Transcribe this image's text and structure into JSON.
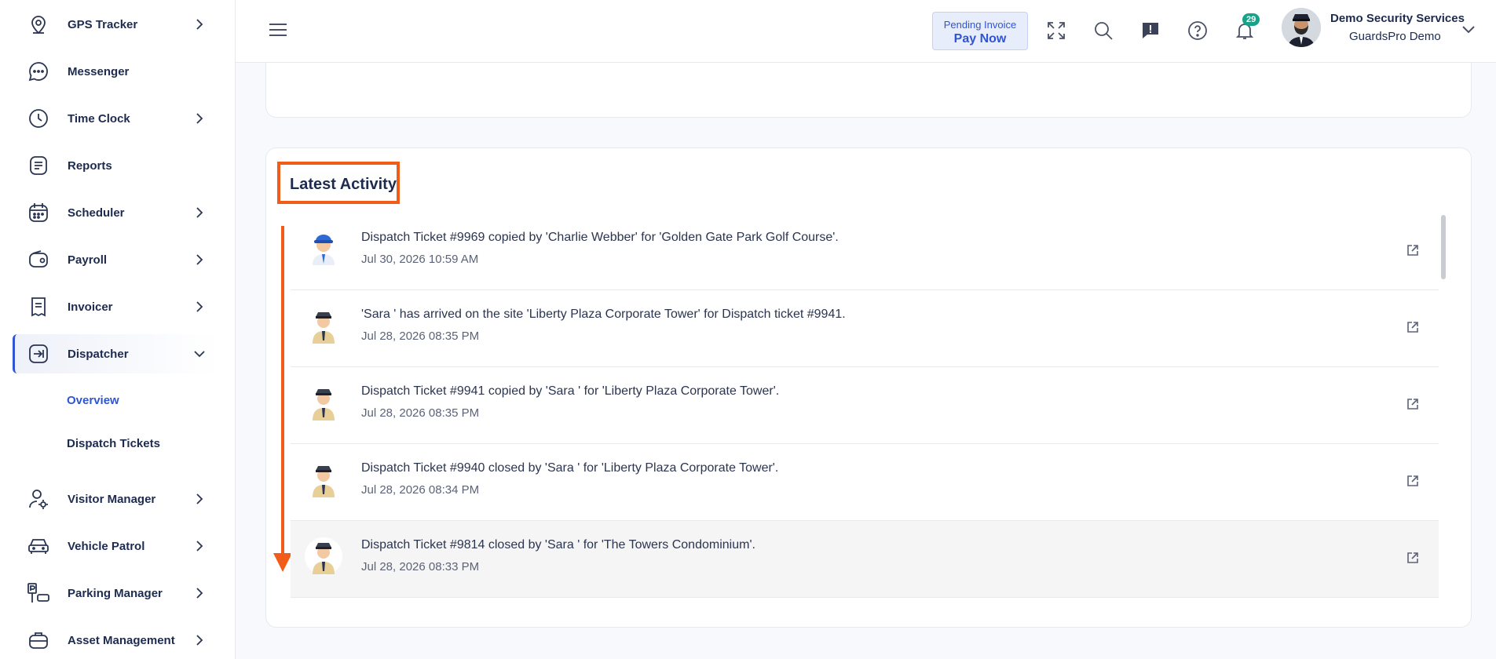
{
  "sidebar": {
    "items": [
      {
        "label": "GPS Tracker",
        "icon": "location-pin-icon"
      },
      {
        "label": "Messenger",
        "icon": "chat-bubble-icon"
      },
      {
        "label": "Time Clock",
        "icon": "clock-icon"
      },
      {
        "label": "Reports",
        "icon": "document-list-icon"
      },
      {
        "label": "Scheduler",
        "icon": "calendar-icon"
      },
      {
        "label": "Payroll",
        "icon": "wallet-icon"
      },
      {
        "label": "Invoicer",
        "icon": "receipt-icon"
      },
      {
        "label": "Dispatcher",
        "icon": "dispatch-icon"
      },
      {
        "label": "Visitor Manager",
        "icon": "visitor-icon"
      },
      {
        "label": "Vehicle Patrol",
        "icon": "car-icon"
      },
      {
        "label": "Parking Manager",
        "icon": "parking-icon"
      },
      {
        "label": "Asset Management",
        "icon": "briefcase-icon"
      }
    ],
    "sub_items": [
      {
        "label": "Overview"
      },
      {
        "label": "Dispatch Tickets"
      }
    ]
  },
  "header": {
    "pending_label": "Pending Invoice",
    "pay_label": "Pay Now",
    "notification_count": "29",
    "user_name": "Demo Security Services",
    "user_org": "GuardsPro Demo"
  },
  "activity": {
    "title": "Latest Activity",
    "items": [
      {
        "message": "Dispatch Ticket #9969 copied by 'Charlie Webber' for 'Golden Gate Park Golf Course'.",
        "time": "Jul 30, 2026 10:59 AM",
        "avatar": "blue-cap-user-avatar-icon"
      },
      {
        "message": "'Sara ' has arrived on the site 'Liberty Plaza Corporate Tower' for Dispatch ticket #9941.",
        "time": "Jul 28, 2026 08:35 PM",
        "avatar": "guard-avatar-icon"
      },
      {
        "message": "Dispatch Ticket #9941 copied by 'Sara ' for 'Liberty Plaza Corporate Tower'.",
        "time": "Jul 28, 2026 08:35 PM",
        "avatar": "guard-avatar-icon"
      },
      {
        "message": "Dispatch Ticket #9940 closed by 'Sara ' for 'Liberty Plaza Corporate Tower'.",
        "time": "Jul 28, 2026 08:34 PM",
        "avatar": "guard-avatar-icon"
      },
      {
        "message": "Dispatch Ticket #9814 closed by 'Sara ' for 'The Towers Condominium'.",
        "time": "Jul 28, 2026 08:33 PM",
        "avatar": "guard-avatar-icon"
      }
    ]
  },
  "colors": {
    "accent": "#2f55d4",
    "annotation": "#f25c19",
    "badge": "#16a389"
  }
}
